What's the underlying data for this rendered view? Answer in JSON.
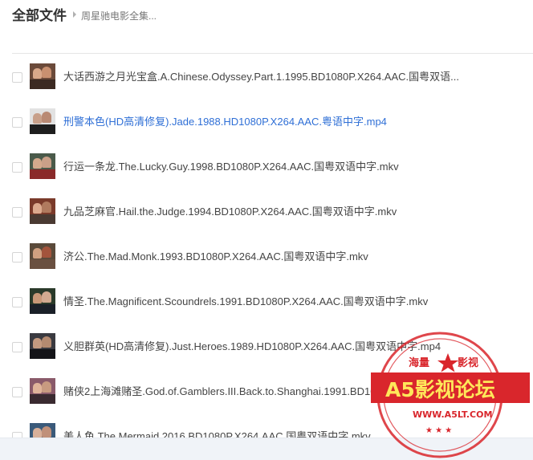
{
  "header": {
    "title": "全部文件",
    "breadcrumb": "周星驰电影全集..."
  },
  "files": [
    {
      "name": "大话西游之月光宝盒.A.Chinese.Odyssey.Part.1.1995.BD1080P.X264.AAC.国粤双语...",
      "highlight": false
    },
    {
      "name": "刑警本色(HD高清修复).Jade.1988.HD1080P.X264.AAC.粤语中字.mp4",
      "highlight": true
    },
    {
      "name": "行运一条龙.The.Lucky.Guy.1998.BD1080P.X264.AAC.国粤双语中字.mkv",
      "highlight": false
    },
    {
      "name": "九品芝麻官.Hail.the.Judge.1994.BD1080P.X264.AAC.国粤双语中字.mkv",
      "highlight": false
    },
    {
      "name": "济公.The.Mad.Monk.1993.BD1080P.X264.AAC.国粤双语中字.mkv",
      "highlight": false
    },
    {
      "name": "情圣.The.Magnificent.Scoundrels.1991.BD1080P.X264.AAC.国粤双语中字.mkv",
      "highlight": false
    },
    {
      "name": "义胆群英(HD高清修复).Just.Heroes.1989.HD1080P.X264.AAC.国粤双语中字.mp4",
      "highlight": false
    },
    {
      "name": "赌侠2上海滩赌圣.God.of.Gamblers.III.Back.to.Shanghai.1991.BD1080P.X264.AAC.国粤双语中字.mkv",
      "highlight": false
    },
    {
      "name": "美人鱼.The.Mermaid.2016.BD1080P.X264.AAC.国粤双语中字.mkv",
      "highlight": false
    }
  ],
  "watermark": {
    "top_left": "海量",
    "top_right": "影视",
    "main": "A5影视论坛",
    "url": "WWW.A5LT.COM"
  },
  "colors": {
    "link": "#2f6fd6",
    "stamp": "#d9262c"
  }
}
